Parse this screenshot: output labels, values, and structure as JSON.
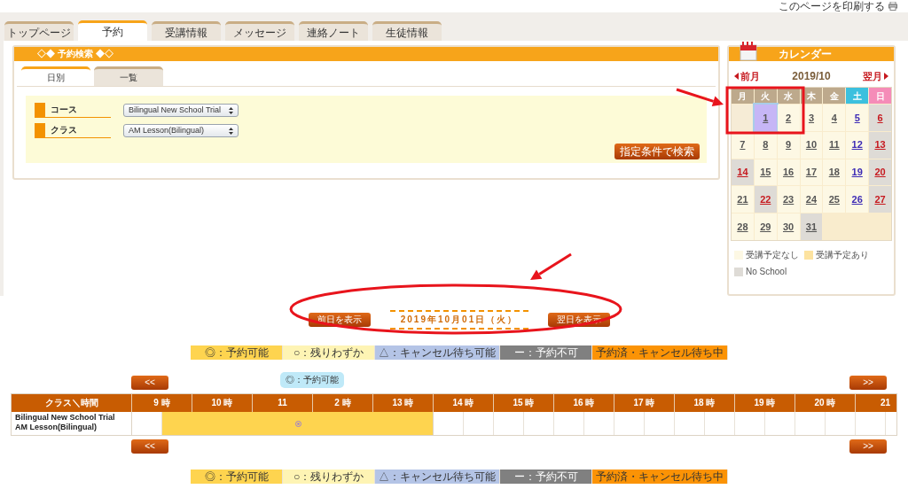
{
  "print_link": "このページを印刷する",
  "tabs": [
    {
      "label": "トップページ",
      "selected": false
    },
    {
      "label": "予約",
      "selected": true
    },
    {
      "label": "受講情報",
      "selected": false
    },
    {
      "label": "メッセージ",
      "selected": false
    },
    {
      "label": "連絡ノート",
      "selected": false
    },
    {
      "label": "生徒情報",
      "selected": false
    }
  ],
  "search_panel": {
    "title": "◇◆ 予約検索 ◆◇",
    "tabs": [
      {
        "label": "日別",
        "selected": true
      },
      {
        "label": "一覧",
        "selected": false
      }
    ],
    "fields": [
      {
        "label": "コース",
        "value": "Bilingual New School Trial"
      },
      {
        "label": "クラス",
        "value": "AM Lesson(Bilingual)"
      }
    ],
    "search_button": "指定条件で検索"
  },
  "calendar": {
    "title": "カレンダー",
    "prev": "前月",
    "month": "2019/10",
    "next": "翌月",
    "weekdays": [
      {
        "label": "月",
        "kind": "weekday"
      },
      {
        "label": "火",
        "kind": "weekday"
      },
      {
        "label": "水",
        "kind": "weekday"
      },
      {
        "label": "木",
        "kind": "weekday"
      },
      {
        "label": "金",
        "kind": "weekday"
      },
      {
        "label": "土",
        "kind": "saturday"
      },
      {
        "label": "日",
        "kind": "sunday"
      }
    ],
    "days": [
      {
        "kind": "blank"
      },
      {
        "label": "1",
        "kind": "weekday",
        "no_school": false,
        "selected": true
      },
      {
        "label": "2",
        "kind": "weekday",
        "no_school": false,
        "selected": false
      },
      {
        "label": "3",
        "kind": "weekday",
        "no_school": false,
        "selected": false
      },
      {
        "label": "4",
        "kind": "weekday",
        "no_school": false,
        "selected": false
      },
      {
        "label": "5",
        "kind": "saturday",
        "no_school": false,
        "selected": false
      },
      {
        "label": "6",
        "kind": "holiday",
        "no_school": true,
        "selected": false
      },
      {
        "label": "7",
        "kind": "weekday",
        "no_school": false,
        "selected": false
      },
      {
        "label": "8",
        "kind": "weekday",
        "no_school": false,
        "selected": false
      },
      {
        "label": "9",
        "kind": "weekday",
        "no_school": false,
        "selected": false
      },
      {
        "label": "10",
        "kind": "weekday",
        "no_school": false,
        "selected": false
      },
      {
        "label": "11",
        "kind": "weekday",
        "no_school": false,
        "selected": false
      },
      {
        "label": "12",
        "kind": "saturday",
        "no_school": false,
        "selected": false
      },
      {
        "label": "13",
        "kind": "holiday",
        "no_school": true,
        "selected": false
      },
      {
        "label": "14",
        "kind": "holiday",
        "no_school": true,
        "selected": false
      },
      {
        "label": "15",
        "kind": "weekday",
        "no_school": false,
        "selected": false
      },
      {
        "label": "16",
        "kind": "weekday",
        "no_school": false,
        "selected": false
      },
      {
        "label": "17",
        "kind": "weekday",
        "no_school": false,
        "selected": false
      },
      {
        "label": "18",
        "kind": "weekday",
        "no_school": false,
        "selected": false
      },
      {
        "label": "19",
        "kind": "saturday",
        "no_school": false,
        "selected": false
      },
      {
        "label": "20",
        "kind": "holiday",
        "no_school": true,
        "selected": false
      },
      {
        "label": "21",
        "kind": "weekday",
        "no_school": false,
        "selected": false
      },
      {
        "label": "22",
        "kind": "holiday",
        "no_school": true,
        "selected": false
      },
      {
        "label": "23",
        "kind": "weekday",
        "no_school": false,
        "selected": false
      },
      {
        "label": "24",
        "kind": "weekday",
        "no_school": false,
        "selected": false
      },
      {
        "label": "25",
        "kind": "weekday",
        "no_school": false,
        "selected": false
      },
      {
        "label": "26",
        "kind": "saturday",
        "no_school": false,
        "selected": false
      },
      {
        "label": "27",
        "kind": "holiday",
        "no_school": true,
        "selected": false
      },
      {
        "label": "28",
        "kind": "weekday",
        "no_school": false,
        "selected": false
      },
      {
        "label": "29",
        "kind": "weekday",
        "no_school": false,
        "selected": false
      },
      {
        "label": "30",
        "kind": "weekday",
        "no_school": false,
        "selected": false
      },
      {
        "label": "31",
        "kind": "weekday",
        "no_school": true,
        "selected": false
      }
    ],
    "legend": [
      {
        "label": "受講予定なし",
        "color": "#fdf8e4"
      },
      {
        "label": "受講予定あり",
        "color": "#fde3a0"
      },
      {
        "label": "No School",
        "color": "#dedbd6"
      }
    ]
  },
  "day_nav": {
    "prev_button": "前日を表示",
    "date": "2019年10月01日（火）",
    "next_button": "翌日を表示"
  },
  "legend_top": [
    {
      "label": "◎：予約可能",
      "color": "#fed44f"
    },
    {
      "label": "○：残りわずか",
      "color": "#fef4b4"
    },
    {
      "label": "△：キャンセル待ち可能",
      "color": "#b4c4e6"
    },
    {
      "label": "ー：予約不可",
      "color": "#808080"
    },
    {
      "label": "予約済・キャンセル待ち中",
      "color": "#fb9305"
    }
  ],
  "schedule": {
    "earlier_button": "<<",
    "later_button": ">>",
    "corner": "クラス＼時間",
    "hours": [
      "9 時",
      "10 時",
      "11",
      "2 時",
      "13 時",
      "14 時",
      "15 時",
      "16 時",
      "17 時",
      "18 時",
      "19 時",
      "20 時",
      "21"
    ],
    "rows": [
      {
        "class_lines": [
          "Bilingual New School Trial",
          "AM Lesson(Bilingual)"
        ],
        "slots": [
          {
            "available": false
          },
          {
            "available": true
          },
          {
            "available": true
          },
          {
            "available": true
          },
          {
            "available": true
          },
          {
            "available": true
          },
          {
            "available": true
          },
          {
            "available": true
          },
          {
            "available": true
          },
          {
            "available": true
          },
          {
            "available": false
          },
          {
            "available": false
          },
          {
            "available": false
          },
          {
            "available": false
          },
          {
            "available": false
          },
          {
            "available": false
          },
          {
            "available": false
          },
          {
            "available": false
          },
          {
            "available": false
          },
          {
            "available": false
          },
          {
            "available": false
          },
          {
            "available": false
          },
          {
            "available": false
          },
          {
            "available": false
          },
          {
            "available": false
          }
        ]
      }
    ],
    "tooltip": "◎：予約可能"
  },
  "legend_bottom": [
    {
      "label": "◎：予約可能",
      "color": "#fed44f"
    },
    {
      "label": "○：残りわずか",
      "color": "#fef4b4"
    },
    {
      "label": "△：キャンセル待ち可能",
      "color": "#b4c4e6"
    },
    {
      "label": "ー：予約不可",
      "color": "#808080"
    },
    {
      "label": "予約済・キャンセル待ち中",
      "color": "#fb9305"
    }
  ],
  "annotations": [
    {
      "kind": "arrow"
    },
    {
      "kind": "box"
    },
    {
      "kind": "arrow"
    },
    {
      "kind": "ellipse"
    }
  ]
}
